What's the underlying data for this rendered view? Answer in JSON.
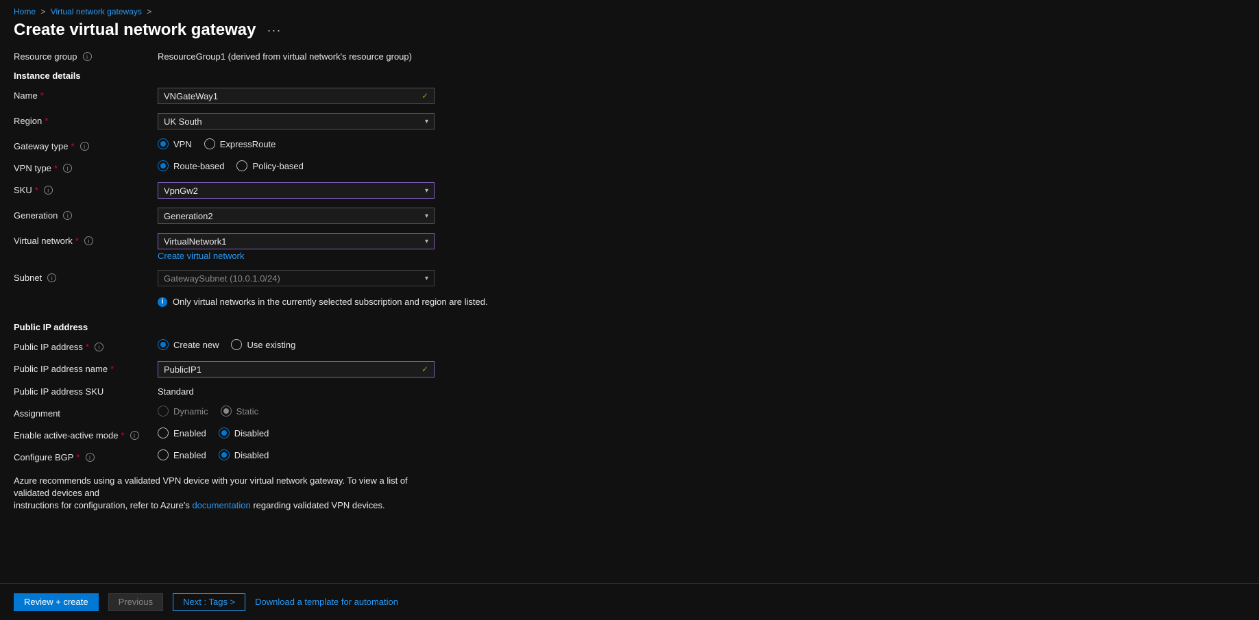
{
  "breadcrumbs": {
    "home": "Home",
    "vng": "Virtual network gateways"
  },
  "page_title": "Create virtual network gateway",
  "labels": {
    "resource_group": "Resource group",
    "instance_details": "Instance details",
    "name": "Name",
    "region": "Region",
    "gateway_type": "Gateway type",
    "vpn_type": "VPN type",
    "sku": "SKU",
    "generation": "Generation",
    "virtual_network": "Virtual network",
    "subnet": "Subnet",
    "public_ip_section": "Public IP address",
    "public_ip_address": "Public IP address",
    "public_ip_name": "Public IP address name",
    "public_ip_sku": "Public IP address SKU",
    "assignment": "Assignment",
    "active_active": "Enable active-active mode",
    "configure_bgp": "Configure BGP"
  },
  "values": {
    "resource_group": "ResourceGroup1 (derived from virtual network's resource group)",
    "name": "VNGateWay1",
    "region": "UK South",
    "sku": "VpnGw2",
    "generation": "Generation2",
    "virtual_network": "VirtualNetwork1",
    "create_vnet_link": "Create virtual network",
    "subnet": "GatewaySubnet (10.0.1.0/24)",
    "vnet_info": "Only virtual networks in the currently selected subscription and region are listed.",
    "public_ip_name": "PublicIP1",
    "public_ip_sku": "Standard"
  },
  "radios": {
    "gateway_type": {
      "vpn": "VPN",
      "expressroute": "ExpressRoute"
    },
    "vpn_type": {
      "route": "Route-based",
      "policy": "Policy-based"
    },
    "public_ip": {
      "create": "Create new",
      "existing": "Use existing"
    },
    "assignment": {
      "dynamic": "Dynamic",
      "static": "Static"
    },
    "enabled": "Enabled",
    "disabled": "Disabled"
  },
  "recommend": {
    "line1": "Azure recommends using a validated VPN device with your virtual network gateway. To view a list of validated devices and",
    "prefix2": "instructions for configuration, refer to Azure's ",
    "link": "documentation",
    "suffix2": " regarding validated VPN devices."
  },
  "footer": {
    "review": "Review + create",
    "previous": "Previous",
    "next": "Next : Tags >",
    "download": "Download a template for automation"
  }
}
